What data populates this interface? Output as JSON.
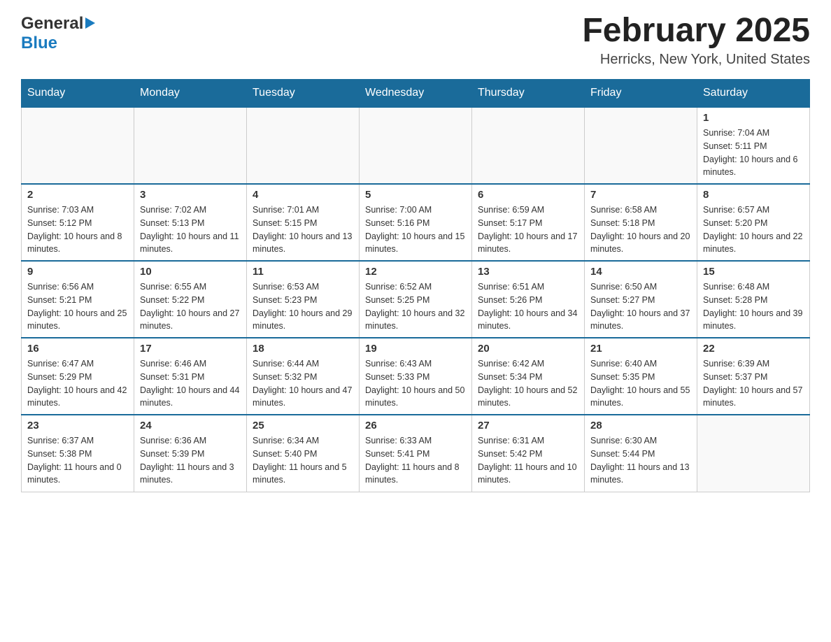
{
  "header": {
    "logo_general": "General",
    "logo_blue": "Blue",
    "month_title": "February 2025",
    "location": "Herricks, New York, United States"
  },
  "days_of_week": [
    "Sunday",
    "Monday",
    "Tuesday",
    "Wednesday",
    "Thursday",
    "Friday",
    "Saturday"
  ],
  "weeks": [
    [
      {
        "day": "",
        "sunrise": "",
        "sunset": "",
        "daylight": ""
      },
      {
        "day": "",
        "sunrise": "",
        "sunset": "",
        "daylight": ""
      },
      {
        "day": "",
        "sunrise": "",
        "sunset": "",
        "daylight": ""
      },
      {
        "day": "",
        "sunrise": "",
        "sunset": "",
        "daylight": ""
      },
      {
        "day": "",
        "sunrise": "",
        "sunset": "",
        "daylight": ""
      },
      {
        "day": "",
        "sunrise": "",
        "sunset": "",
        "daylight": ""
      },
      {
        "day": "1",
        "sunrise": "Sunrise: 7:04 AM",
        "sunset": "Sunset: 5:11 PM",
        "daylight": "Daylight: 10 hours and 6 minutes."
      }
    ],
    [
      {
        "day": "2",
        "sunrise": "Sunrise: 7:03 AM",
        "sunset": "Sunset: 5:12 PM",
        "daylight": "Daylight: 10 hours and 8 minutes."
      },
      {
        "day": "3",
        "sunrise": "Sunrise: 7:02 AM",
        "sunset": "Sunset: 5:13 PM",
        "daylight": "Daylight: 10 hours and 11 minutes."
      },
      {
        "day": "4",
        "sunrise": "Sunrise: 7:01 AM",
        "sunset": "Sunset: 5:15 PM",
        "daylight": "Daylight: 10 hours and 13 minutes."
      },
      {
        "day": "5",
        "sunrise": "Sunrise: 7:00 AM",
        "sunset": "Sunset: 5:16 PM",
        "daylight": "Daylight: 10 hours and 15 minutes."
      },
      {
        "day": "6",
        "sunrise": "Sunrise: 6:59 AM",
        "sunset": "Sunset: 5:17 PM",
        "daylight": "Daylight: 10 hours and 17 minutes."
      },
      {
        "day": "7",
        "sunrise": "Sunrise: 6:58 AM",
        "sunset": "Sunset: 5:18 PM",
        "daylight": "Daylight: 10 hours and 20 minutes."
      },
      {
        "day": "8",
        "sunrise": "Sunrise: 6:57 AM",
        "sunset": "Sunset: 5:20 PM",
        "daylight": "Daylight: 10 hours and 22 minutes."
      }
    ],
    [
      {
        "day": "9",
        "sunrise": "Sunrise: 6:56 AM",
        "sunset": "Sunset: 5:21 PM",
        "daylight": "Daylight: 10 hours and 25 minutes."
      },
      {
        "day": "10",
        "sunrise": "Sunrise: 6:55 AM",
        "sunset": "Sunset: 5:22 PM",
        "daylight": "Daylight: 10 hours and 27 minutes."
      },
      {
        "day": "11",
        "sunrise": "Sunrise: 6:53 AM",
        "sunset": "Sunset: 5:23 PM",
        "daylight": "Daylight: 10 hours and 29 minutes."
      },
      {
        "day": "12",
        "sunrise": "Sunrise: 6:52 AM",
        "sunset": "Sunset: 5:25 PM",
        "daylight": "Daylight: 10 hours and 32 minutes."
      },
      {
        "day": "13",
        "sunrise": "Sunrise: 6:51 AM",
        "sunset": "Sunset: 5:26 PM",
        "daylight": "Daylight: 10 hours and 34 minutes."
      },
      {
        "day": "14",
        "sunrise": "Sunrise: 6:50 AM",
        "sunset": "Sunset: 5:27 PM",
        "daylight": "Daylight: 10 hours and 37 minutes."
      },
      {
        "day": "15",
        "sunrise": "Sunrise: 6:48 AM",
        "sunset": "Sunset: 5:28 PM",
        "daylight": "Daylight: 10 hours and 39 minutes."
      }
    ],
    [
      {
        "day": "16",
        "sunrise": "Sunrise: 6:47 AM",
        "sunset": "Sunset: 5:29 PM",
        "daylight": "Daylight: 10 hours and 42 minutes."
      },
      {
        "day": "17",
        "sunrise": "Sunrise: 6:46 AM",
        "sunset": "Sunset: 5:31 PM",
        "daylight": "Daylight: 10 hours and 44 minutes."
      },
      {
        "day": "18",
        "sunrise": "Sunrise: 6:44 AM",
        "sunset": "Sunset: 5:32 PM",
        "daylight": "Daylight: 10 hours and 47 minutes."
      },
      {
        "day": "19",
        "sunrise": "Sunrise: 6:43 AM",
        "sunset": "Sunset: 5:33 PM",
        "daylight": "Daylight: 10 hours and 50 minutes."
      },
      {
        "day": "20",
        "sunrise": "Sunrise: 6:42 AM",
        "sunset": "Sunset: 5:34 PM",
        "daylight": "Daylight: 10 hours and 52 minutes."
      },
      {
        "day": "21",
        "sunrise": "Sunrise: 6:40 AM",
        "sunset": "Sunset: 5:35 PM",
        "daylight": "Daylight: 10 hours and 55 minutes."
      },
      {
        "day": "22",
        "sunrise": "Sunrise: 6:39 AM",
        "sunset": "Sunset: 5:37 PM",
        "daylight": "Daylight: 10 hours and 57 minutes."
      }
    ],
    [
      {
        "day": "23",
        "sunrise": "Sunrise: 6:37 AM",
        "sunset": "Sunset: 5:38 PM",
        "daylight": "Daylight: 11 hours and 0 minutes."
      },
      {
        "day": "24",
        "sunrise": "Sunrise: 6:36 AM",
        "sunset": "Sunset: 5:39 PM",
        "daylight": "Daylight: 11 hours and 3 minutes."
      },
      {
        "day": "25",
        "sunrise": "Sunrise: 6:34 AM",
        "sunset": "Sunset: 5:40 PM",
        "daylight": "Daylight: 11 hours and 5 minutes."
      },
      {
        "day": "26",
        "sunrise": "Sunrise: 6:33 AM",
        "sunset": "Sunset: 5:41 PM",
        "daylight": "Daylight: 11 hours and 8 minutes."
      },
      {
        "day": "27",
        "sunrise": "Sunrise: 6:31 AM",
        "sunset": "Sunset: 5:42 PM",
        "daylight": "Daylight: 11 hours and 10 minutes."
      },
      {
        "day": "28",
        "sunrise": "Sunrise: 6:30 AM",
        "sunset": "Sunset: 5:44 PM",
        "daylight": "Daylight: 11 hours and 13 minutes."
      },
      {
        "day": "",
        "sunrise": "",
        "sunset": "",
        "daylight": ""
      }
    ]
  ]
}
